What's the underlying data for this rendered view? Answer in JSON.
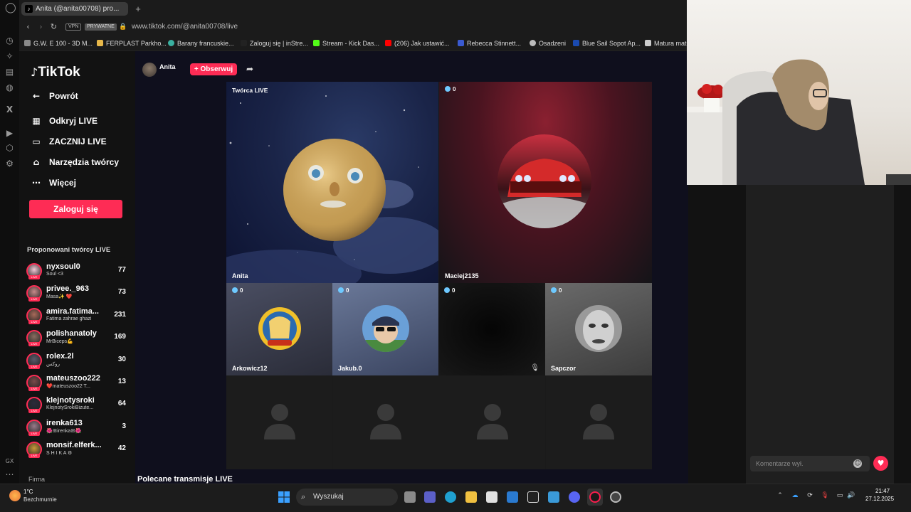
{
  "browser": {
    "tab_title": "Anita (@anita00708) pro...",
    "vpn_label": "VPN",
    "private_label": "PRYWATNE",
    "url": "www.tiktok.com/@anita00708/live",
    "bookmarks": [
      "G.W. E 100 - 3D M...",
      "FERPLAST Parkho...",
      "Barany francuskie...",
      "Zaloguj się | inStre...",
      "Stream - Kick Das...",
      "(206) Jak ustawić...",
      "Rebecca Stinnett...",
      "Osadzeni",
      "Blue Sail Sopot Ap...",
      "Matura mate"
    ]
  },
  "sidebar": {
    "logo": "TikTok",
    "back": "Powrót",
    "nav": [
      "Odkryj LIVE",
      "ZACZNIJ LIVE",
      "Narzędzia twórcy",
      "Więcej"
    ],
    "login": "Zaloguj się",
    "suggested_title": "Proponowani twórcy LIVE",
    "creators": [
      {
        "name": "nyxsoul0",
        "sub": "Soul <3",
        "count": "77",
        "color": "#f3c8d6"
      },
      {
        "name": "privee._963",
        "sub": "Masa✨ ❤️",
        "count": "73",
        "color": "#c78a8a"
      },
      {
        "name": "amira.fatima...",
        "sub": "Fatima zahrae ghazi",
        "count": "231",
        "color": "#a86a5a"
      },
      {
        "name": "polishanatoly",
        "sub": "MrBiceps💪",
        "count": "169",
        "color": "#8a6d60"
      },
      {
        "name": "rolex.2l",
        "sub": "روكس",
        "count": "30",
        "color": "#5a5a6a"
      },
      {
        "name": "mateuszoo222",
        "sub": "❤️mateuszoo22 T...",
        "count": "13",
        "color": "#7a4a4a"
      },
      {
        "name": "klejnotysroki",
        "sub": "KlejnotySrokiBizute...",
        "count": "64",
        "color": "#2a2a3a"
      },
      {
        "name": "irenka613",
        "sub": "🌺ꕥirenkaꕥ🌺",
        "count": "3",
        "color": "#9a7a8a"
      },
      {
        "name": "monsif.elferk...",
        "sub": "S H I K A ⚙",
        "count": "42",
        "color": "#c89a3a"
      }
    ],
    "footer": "Firma"
  },
  "live": {
    "host_name": "Anita",
    "follow": "+ Obserwuj",
    "creator_tag": "Twórca LIVE",
    "tiles_top": [
      {
        "name": "Anita",
        "count": null
      },
      {
        "name": "Maciej2135",
        "count": "0"
      }
    ],
    "tiles_mid": [
      {
        "name": "Arkowicz12",
        "count": "0"
      },
      {
        "name": "Jakub.0",
        "count": "0"
      },
      {
        "name": "",
        "count": "0"
      },
      {
        "name": "Sapczor",
        "count": "0"
      }
    ],
    "recommended": "Polecane transmisje LIVE"
  },
  "chat": {
    "placeholder": "Komentarze wył."
  },
  "taskbar": {
    "temp": "1°C",
    "weather": "Bezchmurnie",
    "search": "Wyszukaj",
    "time": "21:47",
    "date": "27.12.2025"
  },
  "colors": {
    "tiktok_pink": "#fe2c55",
    "gem_blue": "#6ec9ff"
  }
}
